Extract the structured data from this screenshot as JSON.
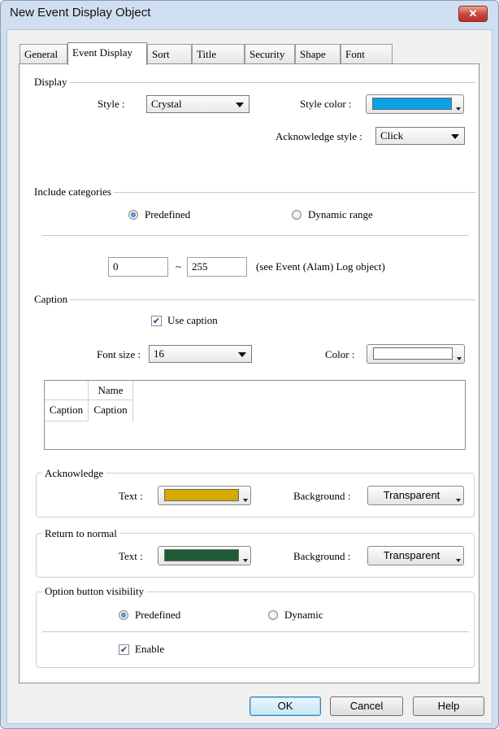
{
  "window": {
    "title": "New Event Display Object",
    "close_glyph": "✕"
  },
  "tabs": [
    "General",
    "Event Display",
    "Sort",
    "Title",
    "Security",
    "Shape",
    "Font"
  ],
  "active_tab": "Event Display",
  "display": {
    "section": "Display",
    "style_label": "Style :",
    "style_value": "Crystal",
    "style_color_label": "Style color :",
    "style_color": "#0aa1e6",
    "ack_style_label": "Acknowledge style :",
    "ack_style_value": "Click"
  },
  "categories": {
    "section": "Include categories",
    "predefined": "Predefined",
    "dynamic_range": "Dynamic range",
    "selected": "Predefined",
    "range_from": "0",
    "range_sep": "~",
    "range_to": "255",
    "note": "(see Event (Alam) Log object)"
  },
  "caption": {
    "section": "Caption",
    "use_caption": "Use caption",
    "use_caption_checked": true,
    "font_size_label": "Font size :",
    "font_size": "16",
    "color_label": "Color :",
    "color": "#ffffff",
    "table": {
      "header": "Name",
      "row_header": "Caption",
      "row_value": "Caption"
    }
  },
  "acknowledge": {
    "section": "Acknowledge",
    "text_label": "Text :",
    "text_color": "#d4aa00",
    "bg_label": "Background :",
    "bg_value": "Transparent"
  },
  "return_normal": {
    "section": "Return to normal",
    "text_label": "Text :",
    "text_color": "#1e5b35",
    "bg_label": "Background :",
    "bg_value": "Transparent"
  },
  "option_visibility": {
    "section": "Option button visibility",
    "predefined": "Predefined",
    "dynamic": "Dynamic",
    "selected": "Predefined",
    "enable": "Enable",
    "enable_checked": true
  },
  "buttons": {
    "ok": "OK",
    "cancel": "Cancel",
    "help": "Help"
  },
  "check_glyph": "✔"
}
